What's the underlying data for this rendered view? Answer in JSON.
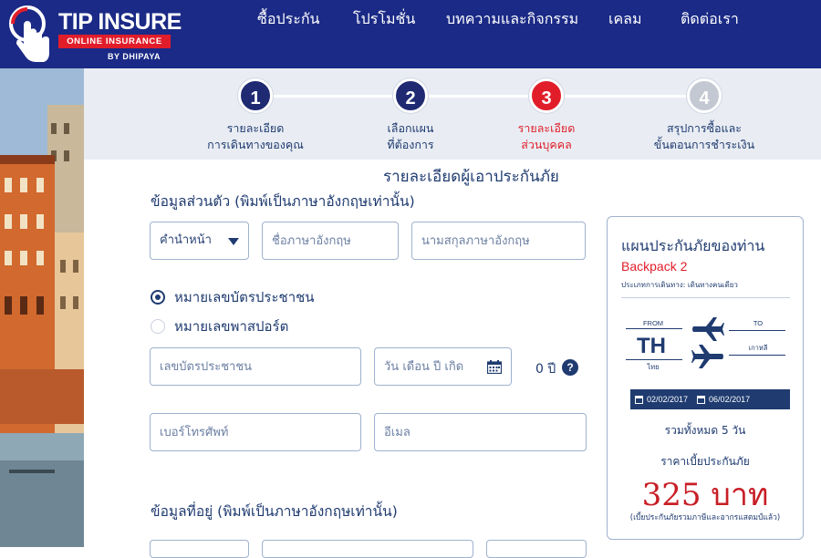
{
  "brand": {
    "name": "TIP INSURE",
    "tagline": "ONLINE INSURANCE",
    "by": "BY DHIPAYA",
    "colors": {
      "navy": "#1b2a86",
      "red": "#e11d2a",
      "step_done": "#1f2a72",
      "step_pending": "#c3c8d2"
    }
  },
  "nav": [
    {
      "label": "ซื้อประกัน"
    },
    {
      "label": "โปรโมชั่น"
    },
    {
      "label": "บทความและกิจกรรม"
    },
    {
      "label": "เคลม"
    },
    {
      "label": "ติดต่อเรา"
    }
  ],
  "steps": [
    {
      "number": "1",
      "line1": "รายละเอียด",
      "line2": "การเดินทางของคุณ",
      "state": "done"
    },
    {
      "number": "2",
      "line1": "เลือกแผน",
      "line2": "ที่ต้องการ",
      "state": "done"
    },
    {
      "number": "3",
      "line1": "รายละเอียด",
      "line2": "ส่วนบุคคล",
      "state": "active"
    },
    {
      "number": "4",
      "line1": "สรุปการซื้อและ",
      "line2": "ขั้นตอนการชำระเงิน",
      "state": "pending"
    }
  ],
  "form": {
    "title": "รายละเอียดผู้เอาประกันภัย",
    "personal_section": "ข้อมูลส่วนตัว (พิมพ์เป็นภาษาอังกฤษเท่านั้น)",
    "title_select": "คำนำหน้า",
    "first_name_placeholder": "ชื่อภาษาอังกฤษ",
    "last_name_placeholder": "นามสกุลภาษาอังกฤษ",
    "id_option": "หมายเลขบัตรประชาชน",
    "passport_option": "หมายเลขพาสปอร์ต",
    "id_placeholder": "เลขบัตรประชาชน",
    "dob_placeholder": "วัน เดือน ปี เกิด",
    "age_text": "0 ปี",
    "phone_placeholder": "เบอร์โทรศัพท์",
    "email_placeholder": "อีเมล",
    "address_section": "ข้อมูลที่อยู่ (พิมพ์เป็นภาษาอังกฤษเท่านั้น)"
  },
  "summary": {
    "title": "แผนประกันภัยของท่าน",
    "plan": "Backpack 2",
    "trip_type": "ประเภทการเดินทาง: เดินทางคนเดียว",
    "from_label": "FROM",
    "from_code": "TH",
    "from_name": "ไทย",
    "to_label": "TO",
    "to_name": "เกาหลี",
    "start_date": "02/02/2017",
    "end_date": "06/02/2017",
    "days_text": "รวมทั้งหมด 5 วัน",
    "price_label": "ราคาเบี้ยประกันภัย",
    "price": "325 บาท",
    "note": "(เบี้ยประกันภัยรวมภาษีและอากรแสตมป์แล้ว)"
  }
}
